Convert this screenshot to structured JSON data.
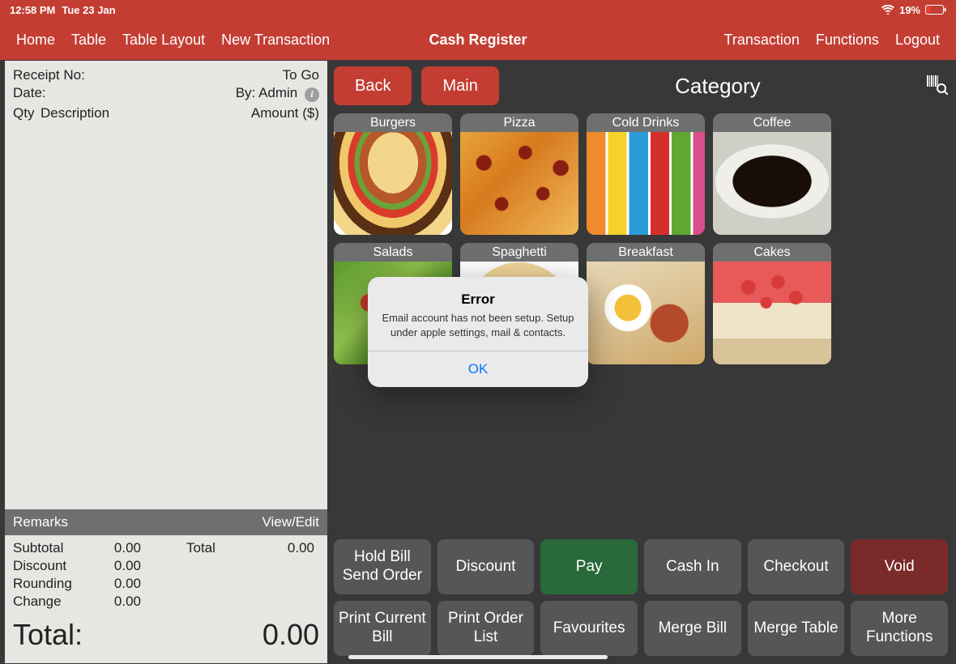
{
  "status": {
    "time": "12:58 PM",
    "date": "Tue 23 Jan",
    "battery": "19%"
  },
  "nav": {
    "left": [
      "Home",
      "Table",
      "Table Layout",
      "New Transaction"
    ],
    "title": "Cash Register",
    "right": [
      "Transaction",
      "Functions",
      "Logout"
    ]
  },
  "receipt": {
    "receipt_no_label": "Receipt No:",
    "to_go": "To Go",
    "date_label": "Date:",
    "by_label": "By: Admin",
    "qty_label": "Qty",
    "desc_label": "Description",
    "amount_label": "Amount ($)",
    "remarks_label": "Remarks",
    "view_edit": "View/Edit",
    "subtotal_label": "Subtotal",
    "subtotal": "0.00",
    "discount_label": "Discount",
    "discount": "0.00",
    "rounding_label": "Rounding",
    "rounding": "0.00",
    "change_label": "Change",
    "change": "0.00",
    "total_right_label": "Total",
    "total_right": "0.00",
    "grand_label": "Total:",
    "grand": "0.00"
  },
  "catbar": {
    "back": "Back",
    "main": "Main",
    "title": "Category"
  },
  "categories": [
    {
      "name": "Burgers",
      "img": "img-burger"
    },
    {
      "name": "Pizza",
      "img": "img-pizza"
    },
    {
      "name": "Cold Drinks",
      "img": "img-drinks"
    },
    {
      "name": "Coffee",
      "img": "img-coffee"
    },
    {
      "name": "Salads",
      "img": "img-salad"
    },
    {
      "name": "Spaghetti",
      "img": "img-spaghetti"
    },
    {
      "name": "Breakfast",
      "img": "img-breakfast"
    },
    {
      "name": "Cakes",
      "img": "img-cakes"
    }
  ],
  "actions_row1": [
    "Hold Bill Send Order",
    "Discount",
    "Pay",
    "Cash In",
    "Checkout",
    "Void"
  ],
  "actions_row2": [
    "Print Current Bill",
    "Print Order List",
    "Favourites",
    "Merge Bill",
    "Merge Table",
    "More Functions"
  ],
  "modal": {
    "title": "Error",
    "message": "Email account has not been setup. Setup under apple settings, mail & contacts.",
    "ok": "OK"
  }
}
